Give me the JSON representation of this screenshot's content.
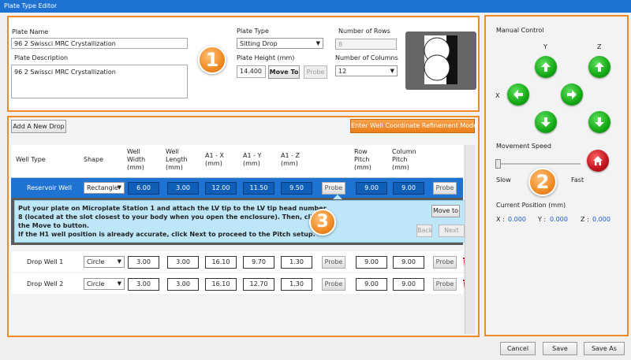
{
  "window": {
    "title": "Plate Type Editor"
  },
  "plate": {
    "name_label": "Plate Name",
    "name_value": "96 2 Swissci MRC Crystallization",
    "desc_label": "Plate Description",
    "desc_value": "96 2 Swissci MRC Crystallization",
    "type_label": "Plate Type",
    "type_value": "Sitting Drop",
    "height_label": "Plate Height (mm)",
    "height_value": "14.400",
    "move_to": "Move To",
    "probe": "Probe",
    "rows_label": "Number of Rows",
    "rows_value": "8",
    "cols_label": "Number of Columns",
    "cols_value": "12"
  },
  "badges": {
    "one": "1",
    "two": "2",
    "three": "3"
  },
  "manual": {
    "title": "Manual Control",
    "y": "Y",
    "z": "Z",
    "x": "X",
    "speed_label": "Movement Speed",
    "slow": "Slow",
    "fast": "Fast",
    "position_label": "Current Position (mm)",
    "x_label": "X :",
    "x_value": "0.000",
    "y_label": "Y :",
    "y_value": "0.000",
    "z_label": "Z :",
    "z_value": "0.000",
    "speed_fraction": 0.0
  },
  "wells": {
    "add_button": "Add A New Drop",
    "refine_button": "Enter Well Coordinate Refinement Mode",
    "headers": {
      "type": "Well Type",
      "shape": "Shape",
      "width": [
        "Well",
        "Width",
        "(mm)"
      ],
      "length": [
        "Well",
        "Length",
        "(mm)"
      ],
      "a1x": [
        "A1 - X",
        "(mm)"
      ],
      "a1y": [
        "A1 - Y",
        "(mm)"
      ],
      "a1z": [
        "A1 - Z",
        "(mm)"
      ],
      "rowpitch": [
        "Row",
        "Pitch",
        "(mm)"
      ],
      "colpitch": [
        "Column",
        "Pitch",
        "(mm)"
      ]
    },
    "probe": "Probe",
    "rows": [
      {
        "type": "Reservoir Well",
        "shape": "Rectangle",
        "width": "6.00",
        "length": "3.00",
        "a1x": "12.00",
        "a1y": "11.50",
        "a1z": "9.50",
        "rowpitch": "9.00",
        "colpitch": "9.00"
      },
      {
        "type": "Drop Well 1",
        "shape": "Circle",
        "width": "3.00",
        "length": "3.00",
        "a1x": "16.10",
        "a1y": "9.70",
        "a1z": "1.30",
        "rowpitch": "9.00",
        "colpitch": "9.00"
      },
      {
        "type": "Drop Well 2",
        "shape": "Circle",
        "width": "3.00",
        "length": "3.00",
        "a1x": "16.10",
        "a1y": "12.70",
        "a1z": "1.30",
        "rowpitch": "9.00",
        "colpitch": "9.00"
      }
    ],
    "instruction": {
      "line1": "Put your plate on Microplate Station 1 and attach the LV tip to the LV tip head number",
      "line2": "8 (located at the slot closest to your body when you open the enclosure). Then, click",
      "line3": "the Move to button.",
      "line4": "If the H1 well position is already accurate, click Next to proceed to the Pitch setup.",
      "move_to": "Move to",
      "back": "Back",
      "next": "Next"
    }
  },
  "footer": {
    "cancel": "Cancel",
    "save": "Save",
    "save_as": "Save As"
  },
  "colors": {
    "accent": "#f08a24",
    "title": "#1e73d2",
    "selected": "#1e73d2",
    "arrow": "#14a814",
    "home": "#c0141e"
  }
}
